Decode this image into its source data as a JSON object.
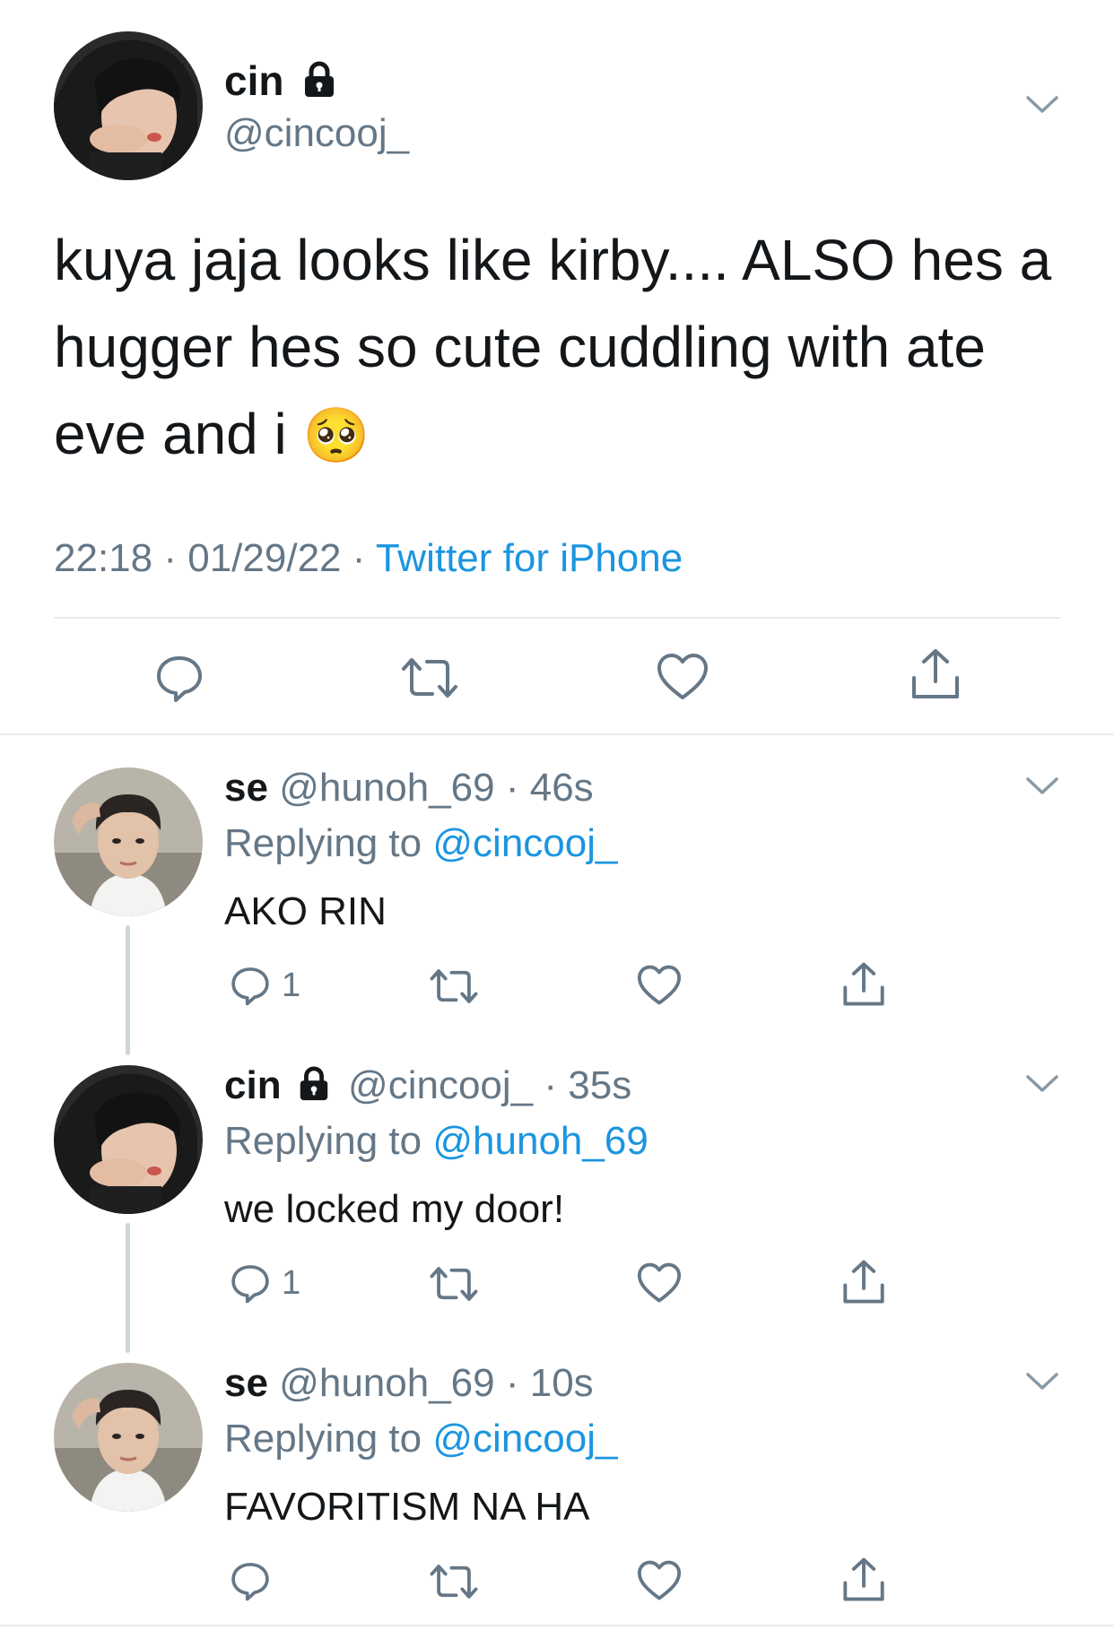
{
  "main_tweet": {
    "name": "cin",
    "handle": "@cincooj_",
    "text": "kuya jaja looks like kirby.... ALSO hes a hugger hes so cute cuddling with ate eve and i",
    "emoji": "🥺",
    "time": "22:18",
    "date": "01/29/22",
    "separator": "·",
    "source": "Twitter for iPhone",
    "icons": [
      "reply-icon",
      "retweet-icon",
      "like-icon",
      "share-icon"
    ]
  },
  "replies": [
    {
      "name": "se",
      "handle": "@hunoh_69",
      "time": "46s",
      "replying_prefix": "Replying to",
      "replying_to": "@cincooj_",
      "text": "AKO RIN",
      "reply_count": "1",
      "locked": false
    },
    {
      "name": "cin",
      "handle": "@cincooj_",
      "time": "35s",
      "replying_prefix": "Replying to",
      "replying_to": "@hunoh_69",
      "text": "we locked my door!",
      "reply_count": "1",
      "locked": true
    },
    {
      "name": "se",
      "handle": "@hunoh_69",
      "time": "10s",
      "replying_prefix": "Replying to",
      "replying_to": "@cincooj_",
      "text": "FAVORITISM NA HA",
      "reply_count": "",
      "locked": false
    }
  ],
  "colors": {
    "text": "#14171a",
    "muted": "#657786",
    "link": "#1b95e0",
    "divider": "#e6ecf0",
    "thread_line": "#ccd6dd"
  }
}
